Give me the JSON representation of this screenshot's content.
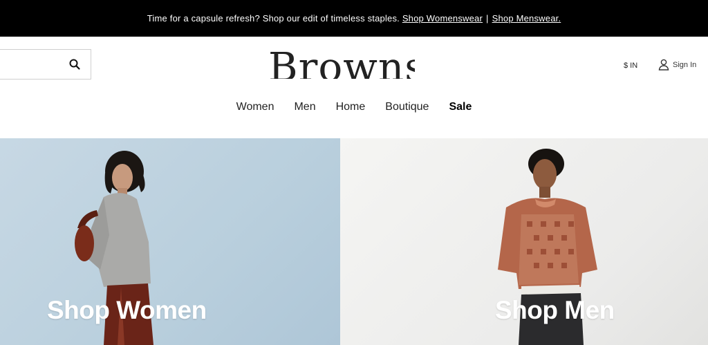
{
  "promo": {
    "text": "Time for a capsule refresh? Shop our edit of timeless staples.",
    "link_women": "Shop Womenswear",
    "separator": "|",
    "link_men": "Shop Menswear."
  },
  "header": {
    "search_placeholder": "",
    "search_icon": "search-icon",
    "logo": "Browns",
    "currency": "$ IN",
    "signin_label": "Sign In",
    "signin_icon": "user-icon"
  },
  "nav": {
    "items": [
      "Women",
      "Men",
      "Home",
      "Boutique",
      "Sale"
    ]
  },
  "hero": {
    "women_label": "Shop Women",
    "men_label": "Shop Men"
  },
  "colors": {
    "promo_bg": "#000000",
    "women_bg": "#c1d5e2",
    "men_bg": "#f0f0ee"
  }
}
